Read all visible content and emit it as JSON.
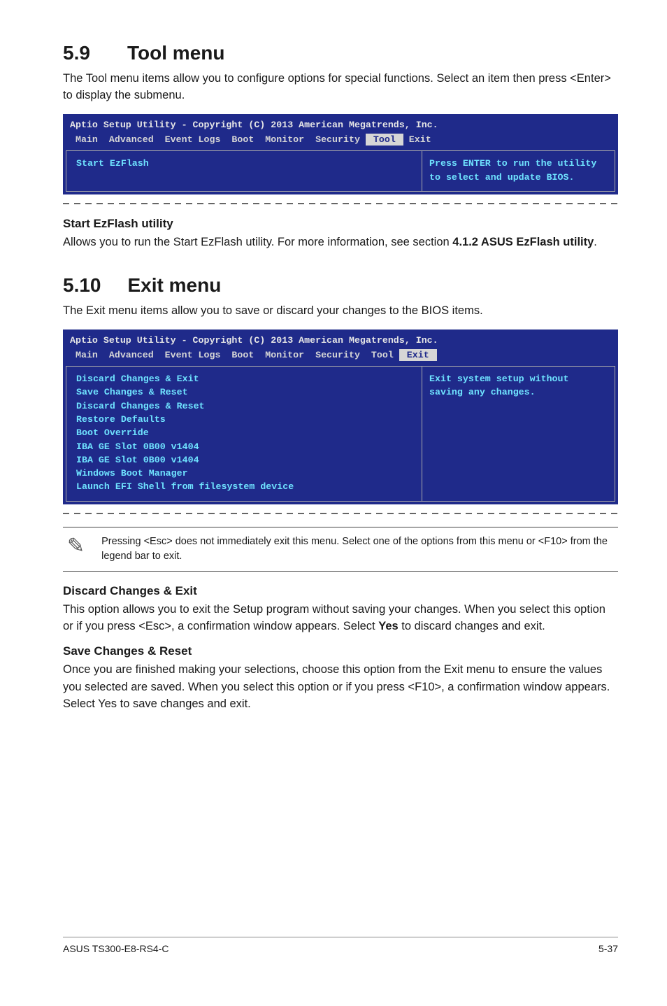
{
  "section1": {
    "num": "5.9",
    "title": "Tool menu",
    "intro": "The Tool menu items allow you to configure options for special functions. Select an item then press <Enter> to display the submenu."
  },
  "bios1": {
    "copyright": "Aptio Setup Utility - Copyright (C) 2013 American Megatrends, Inc.",
    "tabs_pre": " Main  Advanced  Event Logs  Boot  Monitor  Security ",
    "tab_sel": " Tool ",
    "tabs_post": " Exit",
    "left": [
      "Start EzFlash"
    ],
    "right": "Press ENTER to run the utility to select and update BIOS."
  },
  "sub1": {
    "heading": "Start EzFlash utility",
    "line1": "Allows you to run the Start EzFlash utility. For more information, see section ",
    "bold1": "4.1.2 ASUS EzFlash utility",
    "line2": "."
  },
  "section2": {
    "num": "5.10",
    "title": "Exit menu",
    "intro": "The Exit menu items allow you to save or discard your changes to the BIOS items."
  },
  "bios2": {
    "copyright": "Aptio Setup Utility - Copyright (C) 2013 American Megatrends, Inc.",
    "tabs_pre": " Main  Advanced  Event Logs  Boot  Monitor  Security  Tool ",
    "tab_sel": " Exit ",
    "tabs_post": "",
    "left": [
      "Discard Changes & Exit",
      "Save Changes & Reset",
      "Discard Changes & Reset",
      "",
      "Restore Defaults",
      "",
      "Boot Override",
      "IBA GE Slot 0B00 v1404",
      "IBA GE Slot 0B00 v1404",
      "Windows Boot Manager",
      "",
      "Launch EFI Shell from filesystem device"
    ],
    "right": "Exit system setup without saving any changes."
  },
  "note": {
    "text": "Pressing <Esc> does not immediately exit this menu. Select one of the options from this menu or <F10> from the legend bar to exit."
  },
  "sub2": {
    "heading": "Discard Changes & Exit",
    "p_a": "This option allows you to exit the Setup program without saving your changes. When you select this option or if you press <Esc>, a confirmation window appears. Select ",
    "p_b_bold": "Yes",
    "p_c": " to discard changes and exit."
  },
  "sub3": {
    "heading": "Save Changes & Reset",
    "p": "Once you are finished making your selections, choose this option from the Exit menu to ensure the values you selected are saved. When you select this option or if you press <F10>, a confirmation window appears. Select Yes to save changes and exit."
  },
  "footer": {
    "left": "ASUS TS300-E8-RS4-C",
    "right": "5-37"
  }
}
